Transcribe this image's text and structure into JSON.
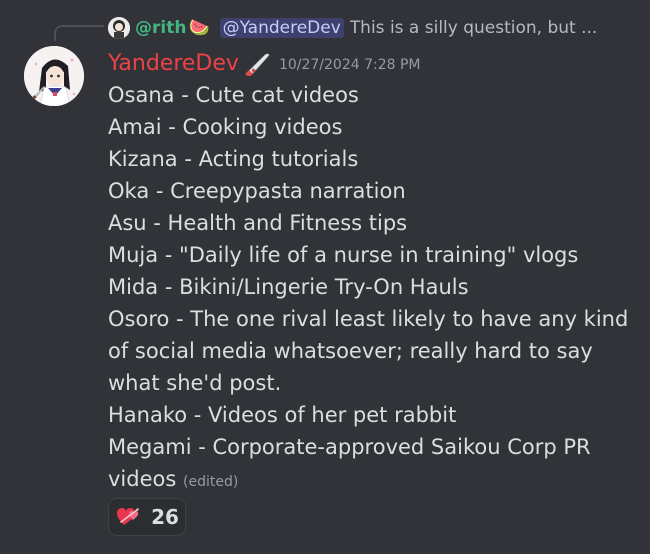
{
  "reply": {
    "author": "@rith",
    "author_emoji": "🍉",
    "mention": "@YandereDev",
    "preview": "This is a silly question, but ..."
  },
  "message": {
    "author": "YandereDev",
    "timestamp": "10/27/2024 7:28 PM",
    "lines": [
      "Osana - Cute cat videos",
      "Amai - Cooking videos",
      "Kizana - Acting tutorials",
      "Oka - Creepypasta narration",
      "Asu - Health and Fitness tips",
      "Muja - \"Daily life of a nurse in training\" vlogs",
      "Mida - Bikini/Lingerie Try-On Hauls",
      "Osoro - The one rival least likely to have any kind",
      "of social media whatsoever; really hard to say",
      "what she'd post.",
      "Hanako - Videos of her pet rabbit",
      "Megami - Corporate-approved Saikou Corp PR",
      "videos"
    ],
    "edited_label": "(edited)"
  },
  "reaction": {
    "icon": "heart-icon",
    "count": "26"
  },
  "colors": {
    "background": "#313338",
    "author": "#ed4245",
    "reply_author": "#43b581",
    "mention_bg": "#5865f24d",
    "text": "#dbdee1",
    "muted": "#949ba4"
  }
}
